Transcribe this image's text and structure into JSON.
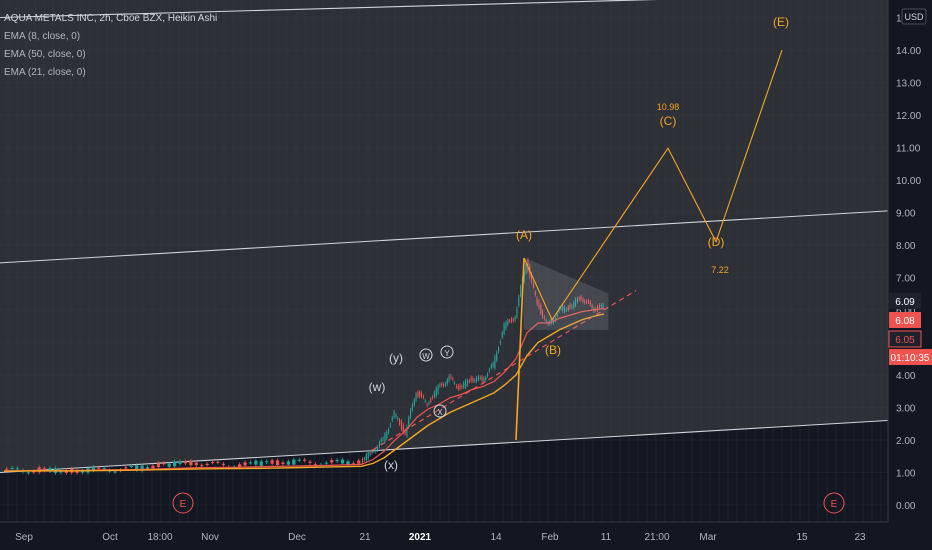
{
  "header": {
    "title": "AQUA METALS INC, 2h, Cboe BZX, Heikin Ashi",
    "indicators": [
      "EMA (8, close, 0)",
      "EMA (50, close, 0)",
      "EMA (21, close, 0)"
    ]
  },
  "colors": {
    "background": "#131722",
    "upper_band_bg": "#2e3038",
    "grid": "#2a2e39",
    "candle_up": "#26a69a",
    "candle_down": "#ef5350",
    "ema_fast": "#ef5350",
    "ema_slow": "#f5a623",
    "wave": "#f5a623",
    "channel": "#d1d4dc",
    "price_tag_blue": "#2f3e66"
  },
  "chart_data": {
    "type": "candlestick",
    "y_axis": {
      "currency": "USD",
      "range": [
        -0.5,
        15.5
      ],
      "ticks": [
        "0.00",
        "1.00",
        "2.00",
        "3.00",
        "4.00",
        "5.00",
        "6.00",
        "7.00",
        "8.00",
        "9.00",
        "10.00",
        "11.00",
        "12.00",
        "13.00",
        "14.00",
        "15.00"
      ]
    },
    "x_axis": {
      "ticks": [
        {
          "label": "Sep",
          "bold": false
        },
        {
          "label": "Oct",
          "bold": false
        },
        {
          "label": "18:00",
          "bold": false
        },
        {
          "label": "Nov",
          "bold": false
        },
        {
          "label": "Dec",
          "bold": false
        },
        {
          "label": "21",
          "bold": false
        },
        {
          "label": "2021",
          "bold": true
        },
        {
          "label": "14",
          "bold": false
        },
        {
          "label": "Feb",
          "bold": false
        },
        {
          "label": "11",
          "bold": false
        },
        {
          "label": "21:00",
          "bold": false
        },
        {
          "label": "Mar",
          "bold": false
        },
        {
          "label": "15",
          "bold": false
        },
        {
          "label": "23",
          "bold": false
        }
      ]
    },
    "price_labels": [
      {
        "text": "6.09",
        "value": 6.09,
        "style": "current"
      },
      {
        "text": "6.08",
        "value": 6.08,
        "style": "red"
      },
      {
        "text": "6.05",
        "value": 6.05,
        "style": "red"
      },
      {
        "text": "01:10:35",
        "value": 5.4,
        "style": "red"
      }
    ],
    "price_path": [
      {
        "t": 0,
        "p": 1.06
      },
      {
        "t": 1,
        "p": 1.08
      },
      {
        "t": 2,
        "p": 1.05
      },
      {
        "t": 3,
        "p": 1.1
      },
      {
        "t": 4,
        "p": 1.12
      },
      {
        "t": 5,
        "p": 1.25
      },
      {
        "t": 6,
        "p": 1.3
      },
      {
        "t": 7,
        "p": 1.2
      },
      {
        "t": 8,
        "p": 1.3
      },
      {
        "t": 9,
        "p": 1.32
      },
      {
        "t": 10,
        "p": 1.3
      },
      {
        "t": 11,
        "p": 1.35
      },
      {
        "t": 12,
        "p": 1.65
      },
      {
        "t": 13,
        "p": 2.0
      },
      {
        "t": 14,
        "p": 2.8
      },
      {
        "t": 15,
        "p": 2.2
      },
      {
        "t": 16,
        "p": 3.5
      },
      {
        "t": 17,
        "p": 3.1
      },
      {
        "t": 18,
        "p": 3.6
      },
      {
        "t": 19,
        "p": 3.9
      },
      {
        "t": 20,
        "p": 3.6
      },
      {
        "t": 21,
        "p": 3.9
      },
      {
        "t": 22,
        "p": 3.85
      },
      {
        "t": 23,
        "p": 4.3
      },
      {
        "t": 24,
        "p": 5.5
      },
      {
        "t": 25,
        "p": 5.8
      },
      {
        "t": 26,
        "p": 7.5
      },
      {
        "t": 27,
        "p": 6.2
      },
      {
        "t": 28,
        "p": 5.5
      },
      {
        "t": 29,
        "p": 6.0
      },
      {
        "t": 30,
        "p": 6.1
      },
      {
        "t": 31,
        "p": 6.4
      },
      {
        "t": 32,
        "p": 6.05
      },
      {
        "t": 33,
        "p": 6.09
      }
    ],
    "ema_fast": [
      1.05,
      1.06,
      1.06,
      1.08,
      1.09,
      1.12,
      1.15,
      1.16,
      1.18,
      1.2,
      1.22,
      1.25,
      1.4,
      1.65,
      2.0,
      2.3,
      2.7,
      2.95,
      3.1,
      3.3,
      3.4,
      3.55,
      3.65,
      3.8,
      4.1,
      4.5,
      5.3,
      5.6,
      5.6,
      5.75,
      5.85,
      5.95,
      6.0,
      6.05
    ],
    "ema_slow": [
      1.04,
      1.05,
      1.05,
      1.06,
      1.07,
      1.09,
      1.11,
      1.12,
      1.13,
      1.15,
      1.17,
      1.19,
      1.28,
      1.45,
      1.7,
      1.95,
      2.2,
      2.45,
      2.65,
      2.85,
      3.0,
      3.15,
      3.3,
      3.45,
      3.7,
      4.0,
      4.6,
      5.0,
      5.2,
      5.4,
      5.55,
      5.7,
      5.8,
      5.88
    ],
    "channel_lines": [
      {
        "name": "upper",
        "x0": 0,
        "y0": 15.0,
        "x1": 1,
        "y1": 15.75
      },
      {
        "name": "middle",
        "x0": 0,
        "y0": 7.45,
        "x1": 1,
        "y1": 9.05
      },
      {
        "name": "lower",
        "x0": 0,
        "y0": 1.0,
        "x1": 1,
        "y1": 2.6
      }
    ],
    "wave_labels": [
      {
        "text": "(w)",
        "circled": false
      },
      {
        "text": "(y)",
        "circled": false
      },
      {
        "text": "W",
        "circled": true
      },
      {
        "text": "X",
        "circled": true
      },
      {
        "text": "Y",
        "circled": true
      },
      {
        "text": "(x)",
        "circled": false
      },
      {
        "text": "(A)",
        "circled": false
      },
      {
        "text": "(B)",
        "circled": false
      },
      {
        "text": "(C)",
        "circled": false
      },
      {
        "text": "(D)",
        "circled": false
      },
      {
        "text": "(E)",
        "circled": false
      }
    ],
    "projection_path": [
      {
        "name": "A",
        "price": 7.6
      },
      {
        "name": "B",
        "price": 5.7
      },
      {
        "name": "C",
        "price": 10.98
      },
      {
        "name": "D",
        "price": 8.1
      },
      {
        "name": "E",
        "price": 14.0
      }
    ],
    "target_labels": [
      {
        "text": "10.98",
        "value": 10.98
      },
      {
        "text": "7.22",
        "value": 7.22
      }
    ],
    "event_markers": [
      "E",
      "E"
    ]
  }
}
